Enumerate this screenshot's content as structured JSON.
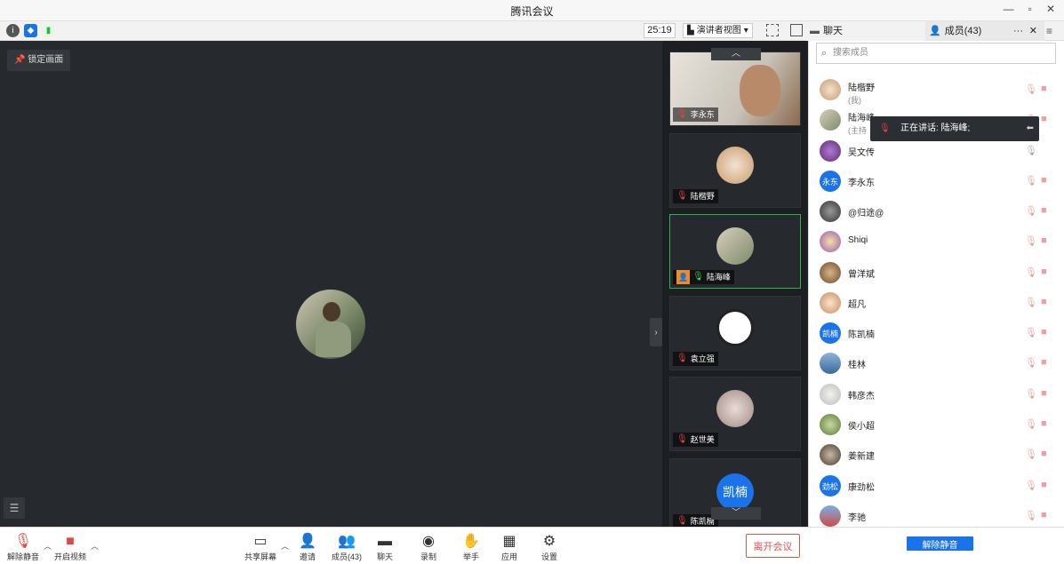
{
  "window": {
    "title": "腾讯会议",
    "minimize": "—",
    "restore": "▫",
    "close": "✕"
  },
  "toolbar": {
    "timer": "25:19",
    "view_label": "演讲者视图",
    "tab_chat": "聊天",
    "tab_members": "成员(43)",
    "tab_more": "···"
  },
  "main": {
    "lock_label": "锁定画面"
  },
  "strip": {
    "tiles": [
      {
        "name": "李永东"
      },
      {
        "name": "陆楷野"
      },
      {
        "name": "陆海峰"
      },
      {
        "name": "袁立强"
      },
      {
        "name": "赵世美"
      },
      {
        "name": "陈凯楠",
        "avatar_text": "凯楠"
      }
    ]
  },
  "panel": {
    "search_placeholder": "搜索成员",
    "members": [
      {
        "name": "陆楷野",
        "sub": "(我)"
      },
      {
        "name": "陆海峰",
        "sub": "(主持"
      },
      {
        "name": "吴文传",
        "sub": ""
      },
      {
        "name": "李永东",
        "sub": "",
        "avatar_text": "永东"
      },
      {
        "name": "@归途@",
        "sub": ""
      },
      {
        "name": "Shiqi",
        "sub": ""
      },
      {
        "name": "曾洋斌",
        "sub": ""
      },
      {
        "name": "超凡",
        "sub": ""
      },
      {
        "name": "陈凯楠",
        "sub": "",
        "avatar_text": "凯楠"
      },
      {
        "name": "桂林",
        "sub": ""
      },
      {
        "name": "韩彦杰",
        "sub": ""
      },
      {
        "name": "侯小超",
        "sub": ""
      },
      {
        "name": "姜新建",
        "sub": ""
      },
      {
        "name": "康劲松",
        "sub": "",
        "avatar_text": "劲松"
      },
      {
        "name": "李驰",
        "sub": ""
      }
    ],
    "speaking_label": "正在讲话: 陆海峰;",
    "mute_all": "解除静音"
  },
  "bottom": {
    "unmute": "解除静音",
    "start_video": "开启视频",
    "share": "共享屏幕",
    "invite": "邀请",
    "members": "成员(43)",
    "chat": "聊天",
    "record": "录制",
    "raise_hand": "举手",
    "apps": "应用",
    "settings": "设置",
    "leave": "离开会议"
  },
  "colors": {
    "accent": "#1a73e8",
    "leave": "#e05151",
    "active_border": "#2cb34a",
    "bg_dark": "#26292d"
  }
}
